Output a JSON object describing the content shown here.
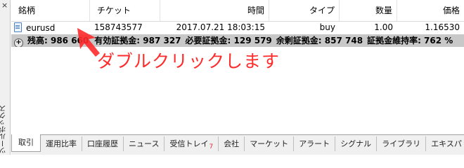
{
  "side": {
    "title": "ツールボックス",
    "close": "×"
  },
  "columns": {
    "symbol": "銘柄",
    "ticket": "チケット",
    "time": "時間",
    "type": "タイプ",
    "volume": "数量",
    "price": "価格"
  },
  "row": {
    "symbol": "eurusd",
    "ticket": "158743577",
    "time": "2017.07.21 18:03:15",
    "type": "buy",
    "volume": "1.00",
    "price": "1.16530"
  },
  "summary": {
    "balance": "残高: 986 660",
    "equity": "有効証拠金: 987 327",
    "margin": "必要証拠金: 129 579",
    "free_margin": "余剰証拠金: 857 748",
    "margin_level": "証拠金維持率: 762 %"
  },
  "annotation": "ダブルクリックします",
  "annotation_color": "#ff2a2a",
  "tabs": [
    {
      "label": "取引",
      "active": true
    },
    {
      "label": "運用比率"
    },
    {
      "label": "口座履歴"
    },
    {
      "label": "ニュース"
    },
    {
      "label": "受信トレイ",
      "badge": "7"
    },
    {
      "label": "会社"
    },
    {
      "label": "マーケット"
    },
    {
      "label": "アラート"
    },
    {
      "label": "シグナル"
    },
    {
      "label": "ライブラリ"
    },
    {
      "label": "エキスパ"
    }
  ]
}
